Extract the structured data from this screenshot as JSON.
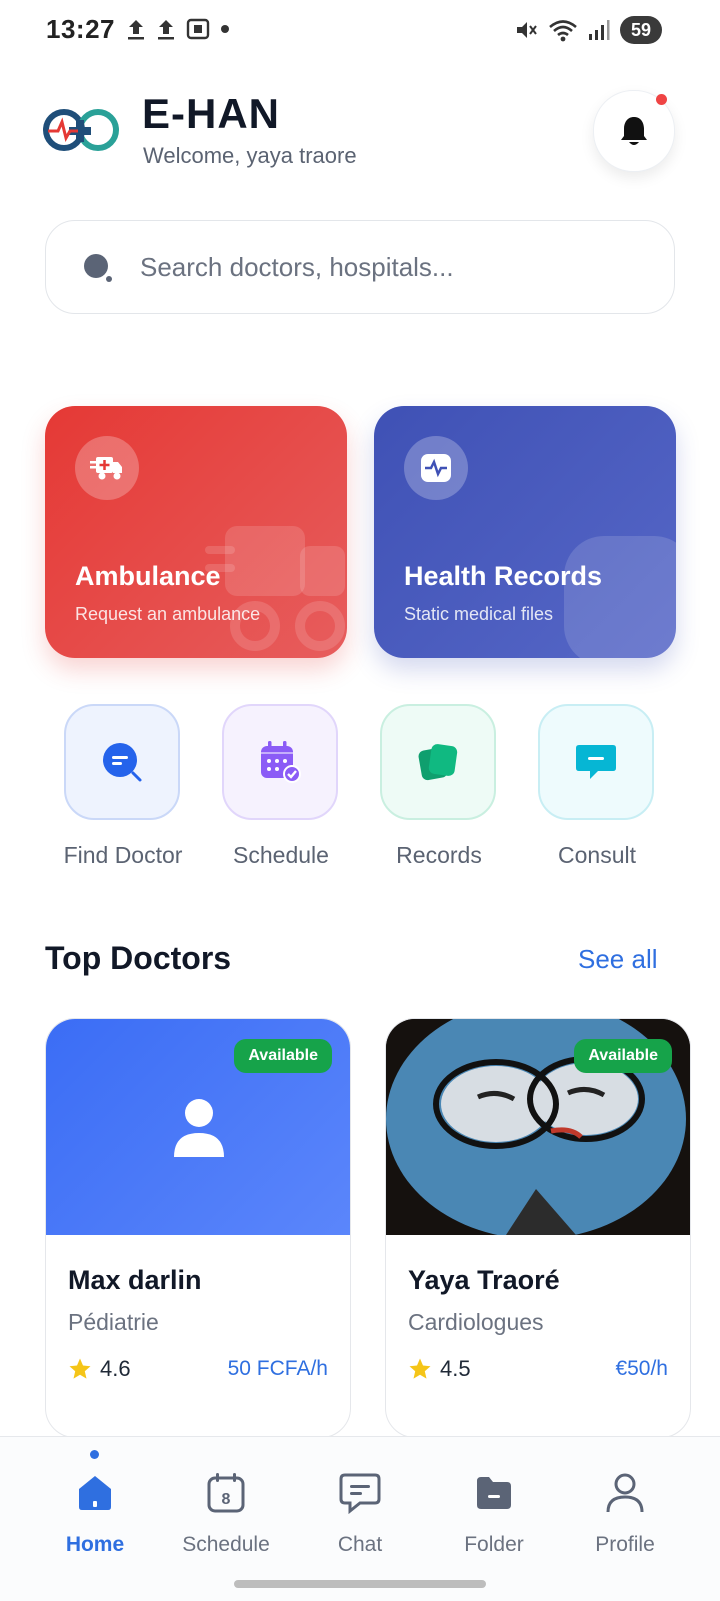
{
  "status_bar": {
    "time": "13:27",
    "battery": "59"
  },
  "header": {
    "app_title": "E-HAN",
    "welcome": "Welcome, yaya traore"
  },
  "search": {
    "placeholder": "Search doctors, hospitals..."
  },
  "feature_cards": [
    {
      "title": "Ambulance",
      "subtitle": "Request an ambulance",
      "color": "#e53935",
      "icon": "ambulance-icon"
    },
    {
      "title": "Health Records",
      "subtitle": "Static medical files",
      "color": "#3f51b5",
      "icon": "health-records-icon"
    }
  ],
  "quick_actions": [
    {
      "label": "Find Doctor",
      "icon": "find-doctor-icon",
      "color": "#2563eb"
    },
    {
      "label": "Schedule",
      "icon": "schedule-icon",
      "color": "#8b5cf6"
    },
    {
      "label": "Records",
      "icon": "records-icon",
      "color": "#10b981"
    },
    {
      "label": "Consult",
      "icon": "consult-icon",
      "color": "#06b6d4"
    }
  ],
  "top_doctors": {
    "title": "Top Doctors",
    "see_all": "See all",
    "doctors": [
      {
        "badge": "Available",
        "name": "Max darlin",
        "specialty": "Pédiatrie",
        "rating": "4.6",
        "price": "50 FCFA/h"
      },
      {
        "badge": "Available",
        "name": "Yaya Traoré",
        "specialty": "Cardiologues",
        "rating": "4.5",
        "price": "€50/h"
      }
    ]
  },
  "bottom_nav": {
    "items": [
      {
        "label": "Home",
        "icon": "home-icon",
        "active": true
      },
      {
        "label": "Schedule",
        "icon": "calendar-icon",
        "badge": "8"
      },
      {
        "label": "Chat",
        "icon": "chat-icon"
      },
      {
        "label": "Folder",
        "icon": "folder-icon"
      },
      {
        "label": "Profile",
        "icon": "profile-icon"
      }
    ]
  },
  "colors": {
    "accent": "#2f6fe0",
    "available": "#16a34a",
    "notification_dot": "#ef4444"
  }
}
